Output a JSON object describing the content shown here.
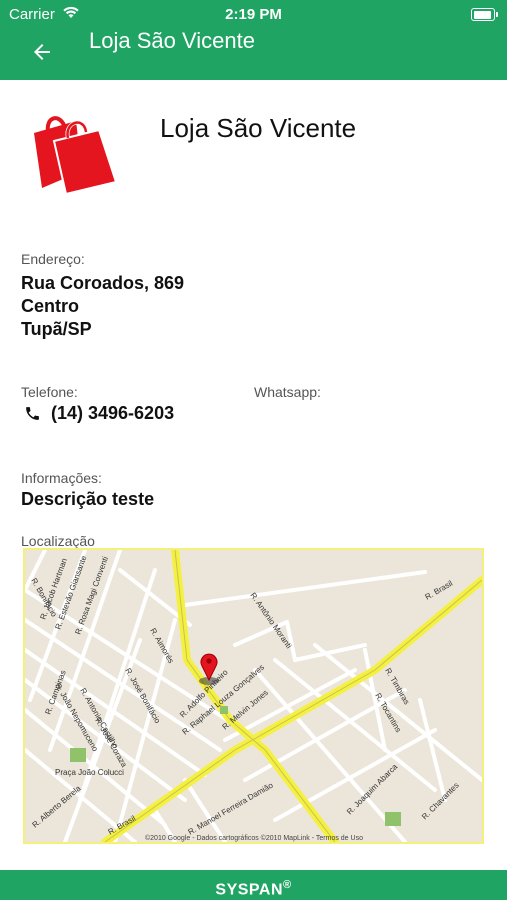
{
  "status_bar": {
    "carrier": "Carrier",
    "time": "2:19 PM"
  },
  "app_bar": {
    "title": "Loja São Vicente",
    "back_icon": "arrow-left-icon"
  },
  "store": {
    "name": "Loja São Vicente",
    "logo_icon": "shopping-bags-icon",
    "logo_color": "#e5151f"
  },
  "address": {
    "label": "Endereço:",
    "street": "Rua Coroados, 869",
    "district": "Centro",
    "city": "Tupã/SP"
  },
  "phone": {
    "label": "Telefone:",
    "number": "(14) 3496-6203",
    "icon": "phone-icon"
  },
  "whatsapp": {
    "label": "Whatsapp:"
  },
  "info": {
    "label": "Informações:",
    "description": "Descrição teste"
  },
  "location": {
    "label": "Localização",
    "streets": [
      "R. Brasil",
      "R. Brasil",
      "R. Antônio Moranti",
      "R. Aimorés",
      "R. Adolfo Pinheiro",
      "R. Raphael Louza Gonçalves",
      "R. Melvin Jones",
      "R. Timbiras",
      "R. Tocantins",
      "R. Alberto Berela",
      "R. Manoel Ferreira Damião",
      "R. Joaquim Abarca",
      "R. Chavantes",
      "R. Jacob Hartman",
      "R. Estevão Giansante",
      "R. Rosa Magi Conventi",
      "R. Bonifácio",
      "R. José Bonifácio",
      "R. Campinas",
      "R. João Nepomuceno",
      "R. Antonio Castilho",
      "R. José Coraza"
    ],
    "place": "Praça João Colucci",
    "attribution": "©2010 Google - Dados cartográficos ©2010 MapLink - Termos de Uso"
  },
  "footer": {
    "brand": "SYSPAN",
    "mark": "®"
  },
  "colors": {
    "primary": "#1fa463",
    "map_major_road": "#f4f042",
    "map_minor_road": "#ffffff"
  }
}
